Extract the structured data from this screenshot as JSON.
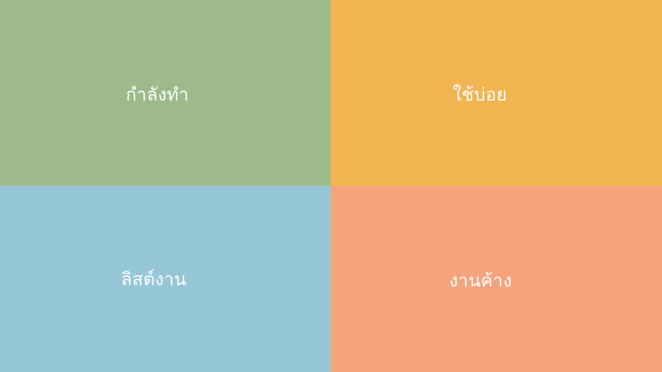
{
  "tiles": [
    {
      "label": "กำลังทำ",
      "color": "#9DBA8A"
    },
    {
      "label": "ใช้บ่อย",
      "color": "#F2B451"
    },
    {
      "label": "ลิสต์งาน",
      "color": "#95C7D6"
    },
    {
      "label": "งานค้าง",
      "color": "#F5A37D"
    }
  ]
}
